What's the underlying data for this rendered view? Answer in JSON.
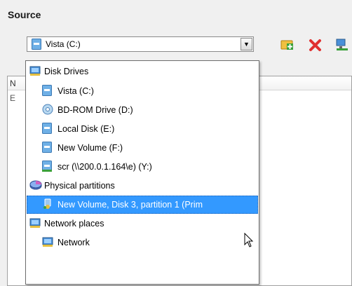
{
  "source": {
    "title": "Source"
  },
  "combo": {
    "value": "Vista (C:)",
    "icon": "drive-icon"
  },
  "toolbar": {
    "buttons": [
      {
        "name": "add-icon",
        "color": "#e8a020"
      },
      {
        "name": "delete-icon",
        "color": "#e03030"
      },
      {
        "name": "network-icon",
        "color": "#3a9a3a"
      }
    ]
  },
  "list_header": {
    "column_fragment": "N",
    "expander": "E"
  },
  "dropdown": {
    "groups": [
      {
        "label": "Disk Drives",
        "icon": "disk-drives-icon",
        "items": [
          {
            "label": "Vista (C:)",
            "icon": "drive-icon"
          },
          {
            "label": "BD-ROM Drive (D:)",
            "icon": "disc-icon"
          },
          {
            "label": "Local Disk (E:)",
            "icon": "drive-icon"
          },
          {
            "label": "New Volume (F:)",
            "icon": "drive-icon"
          },
          {
            "label": "scr (\\\\200.0.1.164\\e) (Y:)",
            "icon": "network-drive-icon"
          }
        ]
      },
      {
        "label": "Physical partitions",
        "icon": "partitions-icon",
        "items": [
          {
            "label": "New Volume, Disk 3, partition 1 (Prim",
            "icon": "partition-icon",
            "selected": true
          }
        ]
      },
      {
        "label": "Network places",
        "icon": "network-places-icon",
        "items": [
          {
            "label": "Network",
            "icon": "network-icon"
          }
        ]
      }
    ]
  },
  "colors": {
    "selection": "#3399ff",
    "drive": "#5aa0d8",
    "background": "#f0f0f0"
  }
}
